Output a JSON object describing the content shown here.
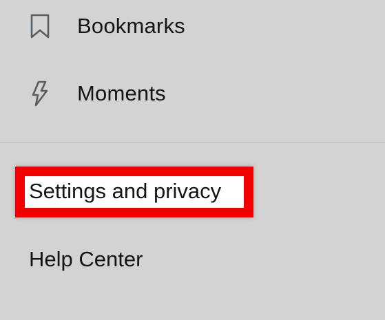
{
  "menu": {
    "items": [
      {
        "label": "Bookmarks",
        "icon": "bookmark-icon"
      },
      {
        "label": "Moments",
        "icon": "lightning-bolt-icon"
      }
    ],
    "settings_label": "Settings and privacy",
    "help_label": "Help Center"
  },
  "colors": {
    "background": "#d3d3d3",
    "text": "#141414",
    "icon_stroke": "#565d63",
    "divider": "#b7bcbf",
    "highlight_border": "#f20000",
    "highlight_fill": "#ffffff"
  }
}
